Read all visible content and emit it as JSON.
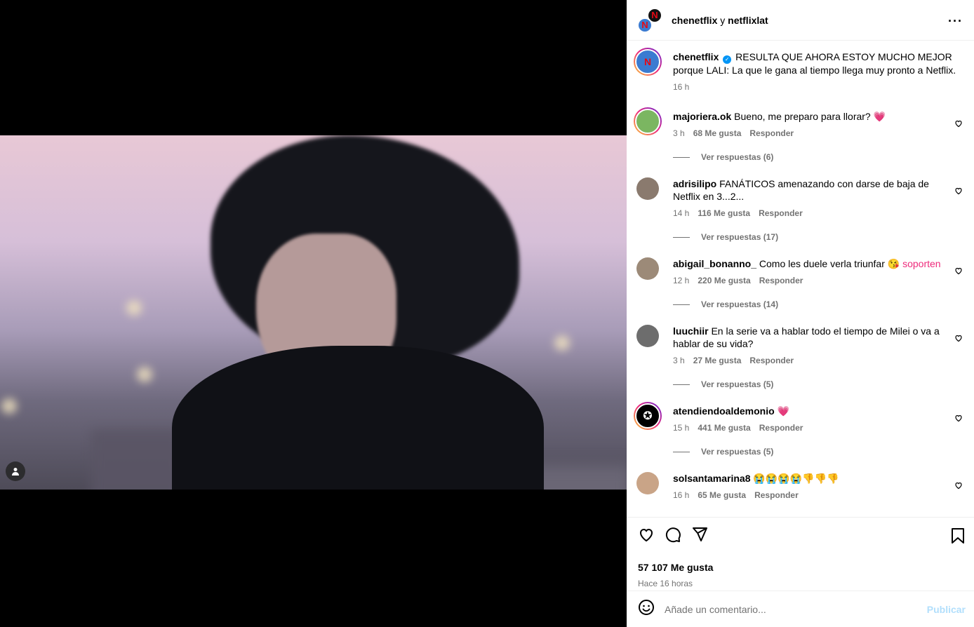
{
  "header": {
    "user1": "chenetflix",
    "conj": " y ",
    "user2": "netflixlat",
    "more_icon": "more-horizontal-icon"
  },
  "caption": {
    "user": "chenetflix",
    "text": "RESULTA QUE AHORA ESTOY MUCHO MEJOR porque LALI: La que le gana al tiempo llega muy pronto a Netflix.",
    "time": "16 h"
  },
  "comments": [
    {
      "user": "majoriera.ok",
      "text": "Bueno, me preparo para llorar?",
      "emoji": "💗",
      "time": "3 h",
      "likes": "68 Me gusta",
      "reply": "Responder",
      "replies": "Ver respuestas (6)",
      "avatar_color": "#7bb661"
    },
    {
      "user": "adrisilipo",
      "text": "FANÁTICOS amenazando con darse de baja de Netflix en 3...2...",
      "emoji": "",
      "time": "14 h",
      "likes": "116 Me gusta",
      "reply": "Responder",
      "replies": "Ver respuestas (17)",
      "avatar_color": "#8a7a6e"
    },
    {
      "user": "abigail_bonanno_",
      "text": "Como les duele verla triunfar",
      "emoji": "😘 soporten",
      "time": "12 h",
      "likes": "220 Me gusta",
      "reply": "Responder",
      "replies": "Ver respuestas (14)",
      "avatar_color": "#9c8a78"
    },
    {
      "user": "luuchiir",
      "text": "En la serie va a hablar todo el tiempo de Milei o va a hablar de su vida?",
      "emoji": "",
      "time": "3 h",
      "likes": "27 Me gusta",
      "reply": "Responder",
      "replies": "Ver respuestas (5)",
      "avatar_color": "#6d6d6d"
    },
    {
      "user": "atendiendoaldemonio",
      "text": "",
      "emoji": "💗",
      "time": "15 h",
      "likes": "441 Me gusta",
      "reply": "Responder",
      "replies": "Ver respuestas (5)",
      "avatar_color": "#000000"
    },
    {
      "user": "solsantamarina8",
      "text": "",
      "emoji": "😭😭😭😭👎👎👎",
      "time": "16 h",
      "likes": "65 Me gusta",
      "reply": "Responder",
      "replies": "",
      "avatar_color": "#c9a487"
    }
  ],
  "actions": {
    "like_icon": "heart-icon",
    "comment_icon": "comment-icon",
    "share_icon": "send-icon",
    "save_icon": "bookmark-icon",
    "likes": "57 107 Me gusta",
    "ago": "Hace 16 horas"
  },
  "add_comment": {
    "placeholder": "Añade un comentario...",
    "post_label": "Publicar",
    "emoji_icon": "smiley-icon"
  },
  "colors": {
    "link": "#0095f6",
    "muted": "#737373",
    "post_disabled": "#b2dffc"
  }
}
